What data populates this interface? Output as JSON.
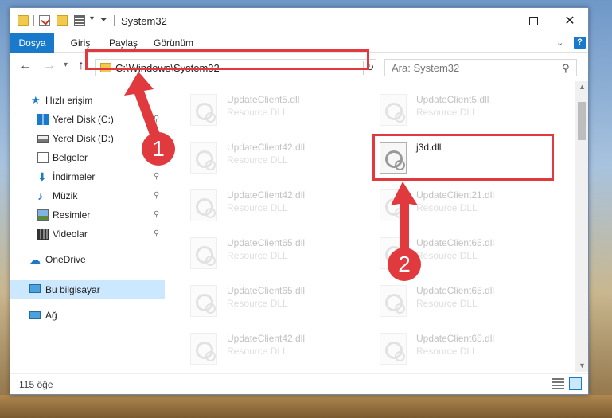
{
  "window": {
    "title": "System32",
    "controls": {
      "minimize": "—",
      "maximize": "☐",
      "close": "✕"
    }
  },
  "ribbon": {
    "tabs": [
      "Dosya",
      "Giriş",
      "Paylaş",
      "Görünüm"
    ],
    "help": "?"
  },
  "navigation": {
    "address_path": "C:\\Windows\\System32",
    "search_placeholder": "Ara: System32"
  },
  "sidebar": {
    "items": [
      {
        "label": "Hızlı erişim",
        "icon": "star-icon"
      },
      {
        "label": "Yerel Disk (C:)",
        "icon": "windows-drive-icon"
      },
      {
        "label": "Yerel Disk (D:)",
        "icon": "drive-icon"
      },
      {
        "label": "Belgeler",
        "icon": "documents-icon"
      },
      {
        "label": "İndirmeler",
        "icon": "download-icon"
      },
      {
        "label": "Müzik",
        "icon": "music-icon"
      },
      {
        "label": "Resimler",
        "icon": "pictures-icon"
      },
      {
        "label": "Videolar",
        "icon": "videos-icon"
      },
      {
        "label": "OneDrive",
        "icon": "cloud-icon"
      },
      {
        "label": "Bu bilgisayar",
        "icon": "computer-icon"
      },
      {
        "label": "Ağ",
        "icon": "network-icon"
      }
    ],
    "selected": "Bu bilgisayar"
  },
  "files": {
    "left_column": [
      {
        "name": "UpdateClient5.dll",
        "type": "Resource DLL"
      },
      {
        "name": "UpdateClient42.dll",
        "type": "Resource DLL"
      },
      {
        "name": "UpdateClient42.dll",
        "type": "Resource DLL"
      },
      {
        "name": "UpdateClient65.dll",
        "type": "Resource DLL"
      },
      {
        "name": "UpdateClient65.dll",
        "type": "Resource DLL"
      },
      {
        "name": "UpdateClient42.dll",
        "type": "Resource DLL"
      }
    ],
    "right_column": [
      {
        "name": "UpdateClient5.dll",
        "type": "Resource DLL"
      },
      {
        "name": "j3d.dll",
        "type": ""
      },
      {
        "name": "UpdateClient21.dll",
        "type": "Resource DLL"
      },
      {
        "name": "UpdateClient65.dll",
        "type": "Resource DLL"
      },
      {
        "name": "UpdateClient65.dll",
        "type": "Resource DLL"
      },
      {
        "name": "UpdateClient65.dll",
        "type": "Resource DLL"
      }
    ]
  },
  "status": {
    "item_count": "115 öğe"
  },
  "annotations": {
    "step_1": "1",
    "step_2": "2",
    "highlight_color": "#e0393e"
  },
  "colors": {
    "accent": "#1979ca",
    "selection": "#cce8ff"
  }
}
